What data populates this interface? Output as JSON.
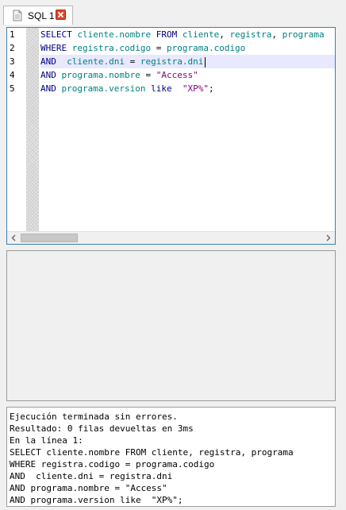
{
  "tab": {
    "title": "SQL 1"
  },
  "editor": {
    "line_numbers": [
      "1",
      "2",
      "3",
      "4",
      "5"
    ],
    "lines": [
      [
        {
          "t": "SELECT ",
          "c": "kw"
        },
        {
          "t": "cliente.nombre",
          "c": "id"
        },
        {
          "t": " FROM ",
          "c": "kw"
        },
        {
          "t": "cliente",
          "c": "id"
        },
        {
          "t": ", ",
          "c": "p"
        },
        {
          "t": "registra",
          "c": "id"
        },
        {
          "t": ", ",
          "c": "p"
        },
        {
          "t": "programa",
          "c": "id"
        }
      ],
      [
        {
          "t": "WHERE ",
          "c": "kw"
        },
        {
          "t": "registra.codigo",
          "c": "id"
        },
        {
          "t": " = ",
          "c": "p"
        },
        {
          "t": "programa.codigo",
          "c": "id"
        }
      ],
      [
        {
          "t": "AND  ",
          "c": "kw"
        },
        {
          "t": "cliente.dni",
          "c": "id"
        },
        {
          "t": " = ",
          "c": "p"
        },
        {
          "t": "registra.dni",
          "c": "id"
        }
      ],
      [
        {
          "t": "AND ",
          "c": "kw"
        },
        {
          "t": "programa.nombre",
          "c": "id"
        },
        {
          "t": " = ",
          "c": "p"
        },
        {
          "t": "\"Access\"",
          "c": "str"
        }
      ],
      [
        {
          "t": "AND ",
          "c": "kw"
        },
        {
          "t": "programa.version",
          "c": "id"
        },
        {
          "t": " like  ",
          "c": "kw"
        },
        {
          "t": "\"XP%\"",
          "c": "str"
        },
        {
          "t": ";",
          "c": "p"
        }
      ]
    ],
    "current_line": 2
  },
  "messages": {
    "lines": [
      "Ejecución terminada sin errores.",
      "Resultado: 0 filas devueltas en 3ms",
      "En la línea 1:",
      "SELECT cliente.nombre FROM cliente, registra, programa",
      "WHERE registra.codigo = programa.codigo",
      "AND  cliente.dni = registra.dni",
      "AND programa.nombre = \"Access\"",
      "AND programa.version like  \"XP%\";"
    ]
  },
  "colors": {
    "keyword": "#00007f",
    "identifier": "#008080",
    "string": "#7f007f",
    "current_line": "#e8e8ff",
    "editor_border": "#3c7fb1",
    "close_button": "#e0472b"
  },
  "icons": {
    "tab": "document-icon",
    "close": "close-icon",
    "scroll_left": "chevron-left-icon",
    "scroll_right": "chevron-right-icon"
  }
}
